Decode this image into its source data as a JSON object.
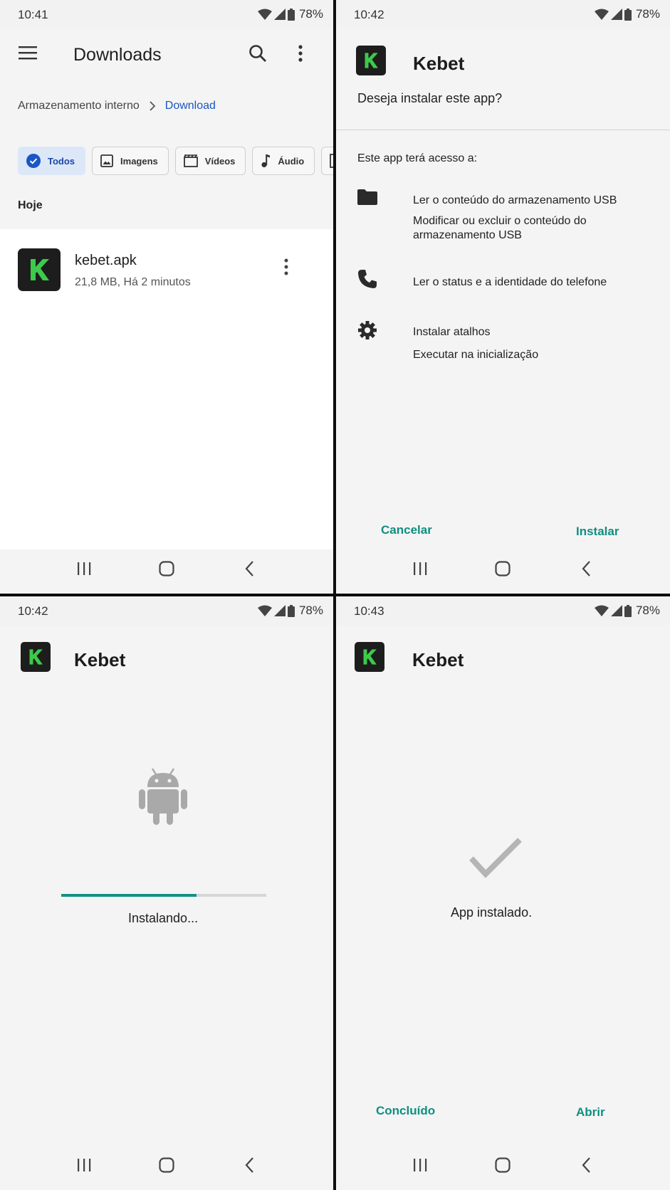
{
  "colors": {
    "accent": "#0e8f80",
    "link": "#1a56c4",
    "chip_selected": "#dce8f8",
    "app_icon_bg": "#1d1d1d",
    "app_icon_letter": "#3ec94a"
  },
  "downloads": {
    "status": {
      "time": "10:41",
      "battery": "78%"
    },
    "title": "Downloads",
    "breadcrumb": {
      "root": "Armazenamento interno",
      "current": "Download"
    },
    "chips": [
      "Todos",
      "Imagens",
      "Vídeos",
      "Áudio"
    ],
    "section": "Hoje",
    "file": {
      "name": "kebet.apk",
      "meta": "21,8 MB, Há 2 minutos",
      "icon_letter": "K"
    }
  },
  "install_prompt": {
    "status": {
      "time": "10:42",
      "battery": "78%"
    },
    "app_name": "Kebet",
    "question": "Deseja instalar este app?",
    "access_title": "Este app terá acesso a:",
    "permissions": [
      {
        "icon": "folder-icon",
        "lines": [
          "Ler o conteúdo do armazenamento USB",
          "Modificar ou excluir o conteúdo do armazenamento USB"
        ]
      },
      {
        "icon": "phone-icon",
        "lines": [
          "Ler o status e a identidade do telefone"
        ]
      },
      {
        "icon": "gear-icon",
        "lines": [
          "Instalar atalhos",
          "Executar na inicialização"
        ]
      }
    ],
    "cancel": "Cancelar",
    "install": "Instalar"
  },
  "installing": {
    "status": {
      "time": "10:42",
      "battery": "78%"
    },
    "app_name": "Kebet",
    "progress": 0.66,
    "message": "Instalando..."
  },
  "installed": {
    "status": {
      "time": "10:43",
      "battery": "78%"
    },
    "app_name": "Kebet",
    "message": "App instalado.",
    "done": "Concluído",
    "open": "Abrir"
  }
}
